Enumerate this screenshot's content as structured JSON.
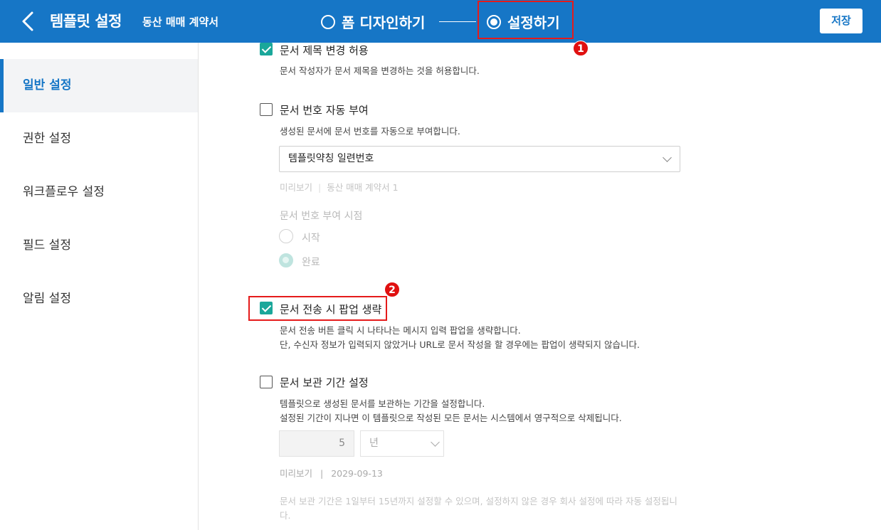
{
  "header": {
    "title": "템플릿 설정",
    "subtitle": "동산 매매 계약서",
    "steps": [
      {
        "label": "폼 디자인하기",
        "selected": false
      },
      {
        "label": "설정하기",
        "selected": true
      }
    ],
    "save_label": "저장"
  },
  "sidebar": {
    "items": [
      {
        "label": "일반 설정",
        "active": true
      },
      {
        "label": "권한 설정",
        "active": false
      },
      {
        "label": "워크플로우 설정",
        "active": false
      },
      {
        "label": "필드 설정",
        "active": false
      },
      {
        "label": "알림 설정",
        "active": false
      }
    ]
  },
  "settings": {
    "title_change": {
      "label": "문서 제목 변경 허용",
      "checked": true,
      "desc": "문서 작성자가 문서 제목을 변경하는 것을 허용합니다."
    },
    "auto_number": {
      "label": "문서 번호 자동 부여",
      "checked": false,
      "desc": "생성된 문서에 문서 번호를 자동으로 부여합니다.",
      "select_value": "템플릿약칭 일련번호",
      "preview_label": "미리보기",
      "preview_value": "동산 매매 계약서 1",
      "timing_label": "문서 번호 부여 시점",
      "options": [
        {
          "label": "시작",
          "selected": false
        },
        {
          "label": "완료",
          "selected": true
        }
      ]
    },
    "skip_popup": {
      "label": "문서 전송 시 팝업 생략",
      "checked": true,
      "desc1": "문서 전송 버튼 클릭 시 나타나는 메시지 입력 팝업을 생략합니다.",
      "desc2": "단, 수신자 정보가 입력되지 않았거나 URL로 문서 작성을 할 경우에는 팝업이 생략되지 않습니다."
    },
    "retention": {
      "label": "문서 보관 기간 설정",
      "checked": false,
      "desc1": "템플릿으로 생성된 문서를 보관하는 기간을 설정합니다.",
      "desc2": "설정된 기간이 지나면 이 템플릿으로 작성된 모든 문서는 시스템에서 영구적으로 삭제됩니다.",
      "value": "5",
      "unit": "년",
      "preview_label": "미리보기",
      "preview_value": "2029-09-13",
      "note_line1": "문서 보관 기간은 1일부터 15년까지 설정할 수 있으며, 설정하지 않은 경우 회사 설정에 따라 자동 설정됩니",
      "note_line2": "다."
    }
  },
  "annotations": {
    "badge1": "1",
    "badge2": "2"
  },
  "colors": {
    "header_bg": "#1676c6",
    "accent": "#1aa79a",
    "highlight": "#e51b1b"
  }
}
